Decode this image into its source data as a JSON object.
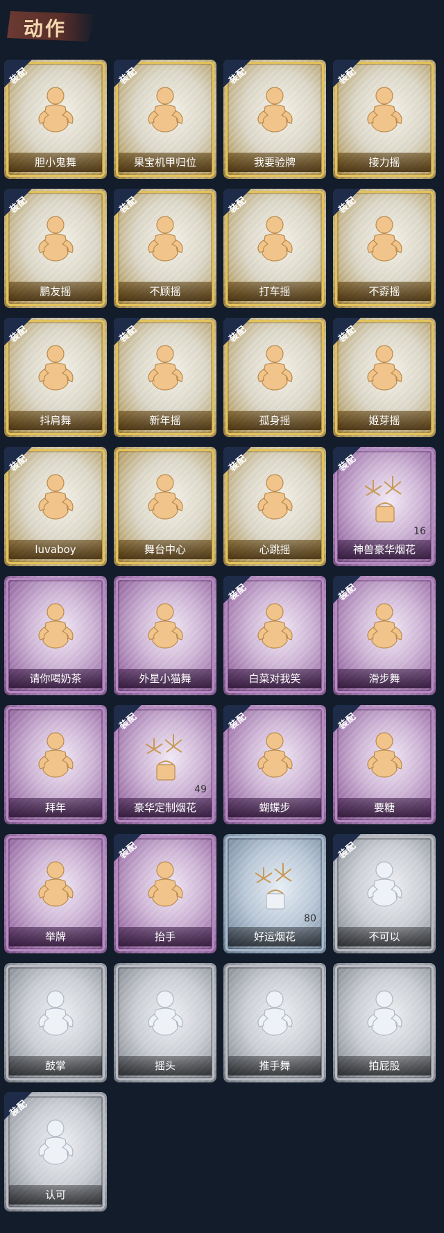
{
  "header": {
    "title": "动作"
  },
  "badge_text": "装配",
  "colors": {
    "gold": "#d4b04a",
    "purple": "#9a6fa6",
    "silver": "#9aa0a8",
    "blue": "#7f93a8",
    "background": "#131c2a"
  },
  "items": [
    {
      "label": "胆小鬼舞",
      "tier": "gold",
      "equipped": true,
      "count": "",
      "icon": "dance-figure-icon"
    },
    {
      "label": "果宝机甲归位",
      "tier": "gold",
      "equipped": true,
      "count": "",
      "icon": "dance-figure-icon"
    },
    {
      "label": "我要验牌",
      "tier": "gold",
      "equipped": true,
      "count": "",
      "icon": "dance-figure-icon"
    },
    {
      "label": "接力摇",
      "tier": "gold",
      "equipped": true,
      "count": "",
      "icon": "dance-figure-icon"
    },
    {
      "label": "鹏友摇",
      "tier": "gold",
      "equipped": true,
      "count": "",
      "icon": "dance-figure-icon"
    },
    {
      "label": "不顾摇",
      "tier": "gold",
      "equipped": true,
      "count": "",
      "icon": "dance-figure-icon"
    },
    {
      "label": "打车摇",
      "tier": "gold",
      "equipped": true,
      "count": "",
      "icon": "dance-figure-icon"
    },
    {
      "label": "不孬摇",
      "tier": "gold",
      "equipped": true,
      "count": "",
      "icon": "dance-figure-icon"
    },
    {
      "label": "抖肩舞",
      "tier": "gold",
      "equipped": true,
      "count": "",
      "icon": "dance-figure-icon"
    },
    {
      "label": "新年摇",
      "tier": "gold",
      "equipped": true,
      "count": "",
      "icon": "dance-figure-icon"
    },
    {
      "label": "孤身摇",
      "tier": "gold",
      "equipped": true,
      "count": "",
      "icon": "dance-figure-icon"
    },
    {
      "label": "姬芽摇",
      "tier": "gold",
      "equipped": true,
      "count": "",
      "icon": "dance-figure-icon"
    },
    {
      "label": "luvaboy",
      "tier": "gold",
      "equipped": true,
      "count": "",
      "icon": "dance-figure-icon"
    },
    {
      "label": "舞台中心",
      "tier": "gold",
      "equipped": false,
      "count": "",
      "icon": "dance-figure-icon"
    },
    {
      "label": "心跳摇",
      "tier": "gold",
      "equipped": true,
      "count": "",
      "icon": "dance-figure-icon"
    },
    {
      "label": "神兽豪华烟花",
      "tier": "purple",
      "equipped": true,
      "count": "16",
      "icon": "fireworks-icon"
    },
    {
      "label": "请你喝奶茶",
      "tier": "purple",
      "equipped": false,
      "count": "",
      "icon": "sign-figure-icon"
    },
    {
      "label": "外星小猫舞",
      "tier": "purple",
      "equipped": false,
      "count": "",
      "icon": "dance-figure-icon"
    },
    {
      "label": "白菜对我笑",
      "tier": "purple",
      "equipped": true,
      "count": "",
      "icon": "dance-figure-icon"
    },
    {
      "label": "滑步舞",
      "tier": "purple",
      "equipped": true,
      "count": "",
      "icon": "dance-figure-icon"
    },
    {
      "label": "拜年",
      "tier": "purple",
      "equipped": false,
      "count": "",
      "icon": "bow-figure-icon"
    },
    {
      "label": "豪华定制烟花",
      "tier": "purple",
      "equipped": true,
      "count": "49",
      "icon": "fireworks-icon"
    },
    {
      "label": "蝴蝶步",
      "tier": "purple",
      "equipped": true,
      "count": "",
      "icon": "dance-figure-icon"
    },
    {
      "label": "要糖",
      "tier": "purple",
      "equipped": true,
      "count": "",
      "icon": "dance-figure-icon"
    },
    {
      "label": "举牌",
      "tier": "purple",
      "equipped": false,
      "count": "",
      "icon": "sign-figure-icon"
    },
    {
      "label": "抬手",
      "tier": "purple",
      "equipped": true,
      "count": "",
      "icon": "dance-figure-icon"
    },
    {
      "label": "好运烟花",
      "tier": "blue",
      "equipped": false,
      "count": "80",
      "icon": "fireworks-icon"
    },
    {
      "label": "不可以",
      "tier": "silver",
      "equipped": true,
      "count": "",
      "icon": "finger-wag-icon"
    },
    {
      "label": "鼓掌",
      "tier": "silver",
      "equipped": false,
      "count": "",
      "icon": "clap-icon"
    },
    {
      "label": "摇头",
      "tier": "silver",
      "equipped": false,
      "count": "",
      "icon": "dance-figure-icon"
    },
    {
      "label": "推手舞",
      "tier": "silver",
      "equipped": false,
      "count": "",
      "icon": "dance-figure-icon"
    },
    {
      "label": "拍屁股",
      "tier": "silver",
      "equipped": false,
      "count": "",
      "icon": "dance-figure-icon"
    },
    {
      "label": "认可",
      "tier": "silver",
      "equipped": true,
      "count": "",
      "icon": "thumbs-up-icon"
    }
  ]
}
